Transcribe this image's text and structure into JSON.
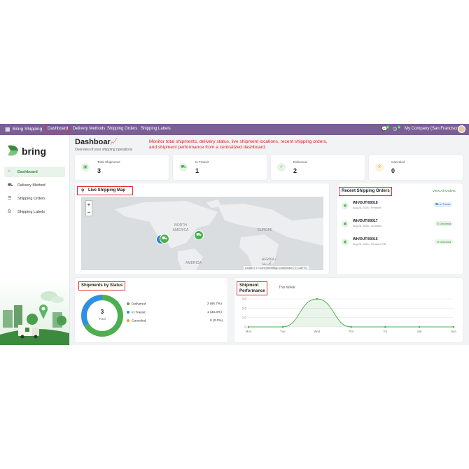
{
  "navbar": {
    "app_name": "Bring Shipping",
    "menu": [
      "Dashboard",
      "Delivery Methods",
      "Shipping Orders",
      "Shipping Labels"
    ],
    "company": "My Company (San Francisco)",
    "chat_count": "8",
    "activity_count": "6"
  },
  "brand": {
    "name": "bring",
    "color": "#3b8a3e"
  },
  "sidebar": {
    "items": [
      {
        "label": "Dashboard",
        "icon": "home-icon"
      },
      {
        "label": "Delivery Method",
        "icon": "truck-icon"
      },
      {
        "label": "Shipping Orders",
        "icon": "list-icon"
      },
      {
        "label": "Shipping Labels",
        "icon": "printer-icon"
      }
    ]
  },
  "header": {
    "title": "Dashboard",
    "subtitle": "Overview of your shipping operations",
    "annotation_line1": "Monitor total shipments, delivery status, live shipment locations, recent shipping orders,",
    "annotation_line2": "and shipment performance from a centralized dashboard."
  },
  "stats": [
    {
      "label": "Total Shipments",
      "value": "3",
      "color": "#4caf50",
      "icon": "box-icon"
    },
    {
      "label": "In Transit",
      "value": "1",
      "color": "#4caf50",
      "icon": "truck-icon"
    },
    {
      "label": "Delivered",
      "value": "2",
      "color": "#4caf50",
      "icon": "check-icon"
    },
    {
      "label": "Canceled",
      "value": "0",
      "color": "#f0a030",
      "icon": "x-icon"
    }
  ],
  "map": {
    "title": "Live Shipping Map",
    "zoom_in": "+",
    "zoom_out": "−",
    "labels": {
      "north_america": "NORTH AMERICA",
      "europe": "EUROPE",
      "africa": "AFRIKA / أفريقيا",
      "america": "AMERICA"
    },
    "attribution": "Leaflet | © OpenStreetMap contributors © CARTO"
  },
  "recent": {
    "title": "Recent Shipping Orders",
    "view_all": "View All Orders",
    "orders": [
      {
        "id": "WH/OUT/00018",
        "meta": "Aug 26, 2026 • Fremont",
        "status": "In Transit",
        "status_color": "#2f80d0",
        "status_bg": "#e3effa"
      },
      {
        "id": "WH/OUT/00017",
        "meta": "Aug 26, 2026 • Scranton",
        "status": "Delivered",
        "status_color": "#3b8a3e",
        "status_bg": "#e5f4e6"
      },
      {
        "id": "WH/OUT/00016",
        "meta": "Aug 26, 2026 • Pleasant Hill",
        "status": "Delivered",
        "status_color": "#3b8a3e",
        "status_bg": "#e5f4e6"
      }
    ]
  },
  "status_panel": {
    "title": "Shipments by Status",
    "center_value": "3",
    "center_label": "Total",
    "legend": [
      {
        "name": "Delivered",
        "count": "2 (66.7%)",
        "color": "#4caf50"
      },
      {
        "name": "In Transit",
        "count": "1 (33.3%)",
        "color": "#2f8fe0"
      },
      {
        "name": "Canceled",
        "count": "0 (0.0%)",
        "color": "#f0a030"
      }
    ]
  },
  "performance": {
    "title_line1": "Shipment",
    "title_line2": "Performance",
    "period": "This Week"
  },
  "chart_data": [
    {
      "type": "pie",
      "categories": [
        "Delivered",
        "In Transit",
        "Canceled"
      ],
      "values": [
        2,
        1,
        0
      ],
      "colors": [
        "#4caf50",
        "#2f8fe0",
        "#f0a030"
      ]
    },
    {
      "type": "area",
      "categories": [
        "Mon",
        "Tue",
        "Wed",
        "Thu",
        "Fri",
        "Sat",
        "Sun"
      ],
      "values": [
        0,
        0,
        3,
        0,
        0,
        0,
        0
      ],
      "ylim": [
        0,
        3
      ],
      "yticks": [
        "0",
        "1.0",
        "2.0",
        "3.0"
      ],
      "color": "#4caf50",
      "grid": true
    }
  ]
}
